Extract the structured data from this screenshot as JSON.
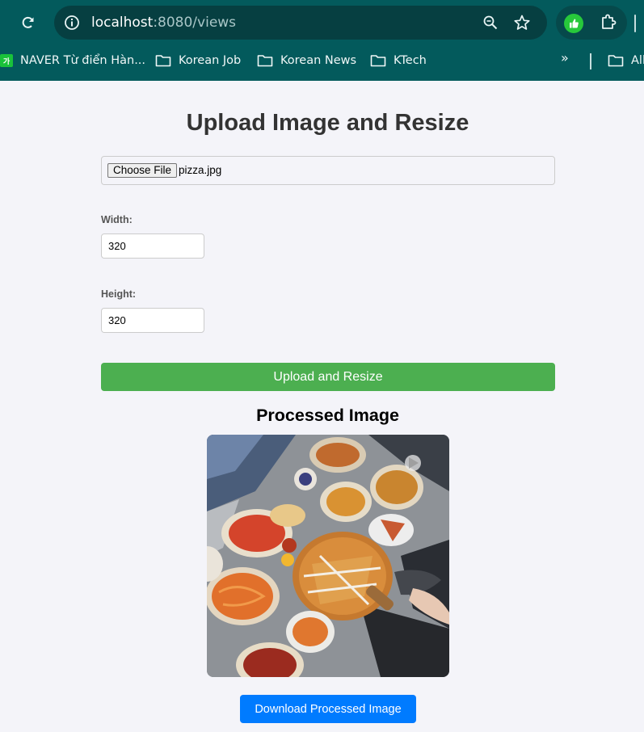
{
  "browser": {
    "url_host": "localhost",
    "url_rest": ":8080/views",
    "bookmarks": [
      {
        "label": "NAVER Từ điển Hàn...",
        "icon": "naver-icon"
      },
      {
        "label": "Korean Job",
        "icon": "folder-icon"
      },
      {
        "label": "Korean News",
        "icon": "folder-icon"
      },
      {
        "label": "KTech",
        "icon": "folder-icon"
      }
    ],
    "more_label": "»",
    "all_label": "All"
  },
  "page": {
    "title": "Upload Image and Resize",
    "file_button": "Choose File",
    "file_name": "pizza.jpg",
    "width_label": "Width:",
    "width_value": "320",
    "height_label": "Height:",
    "height_value": "320",
    "submit_label": "Upload and Resize",
    "processed_heading": "Processed Image",
    "download_label": "Download Processed Image"
  },
  "colors": {
    "chrome": "#035a5c",
    "submit": "#4caf50",
    "download": "#007bff"
  }
}
